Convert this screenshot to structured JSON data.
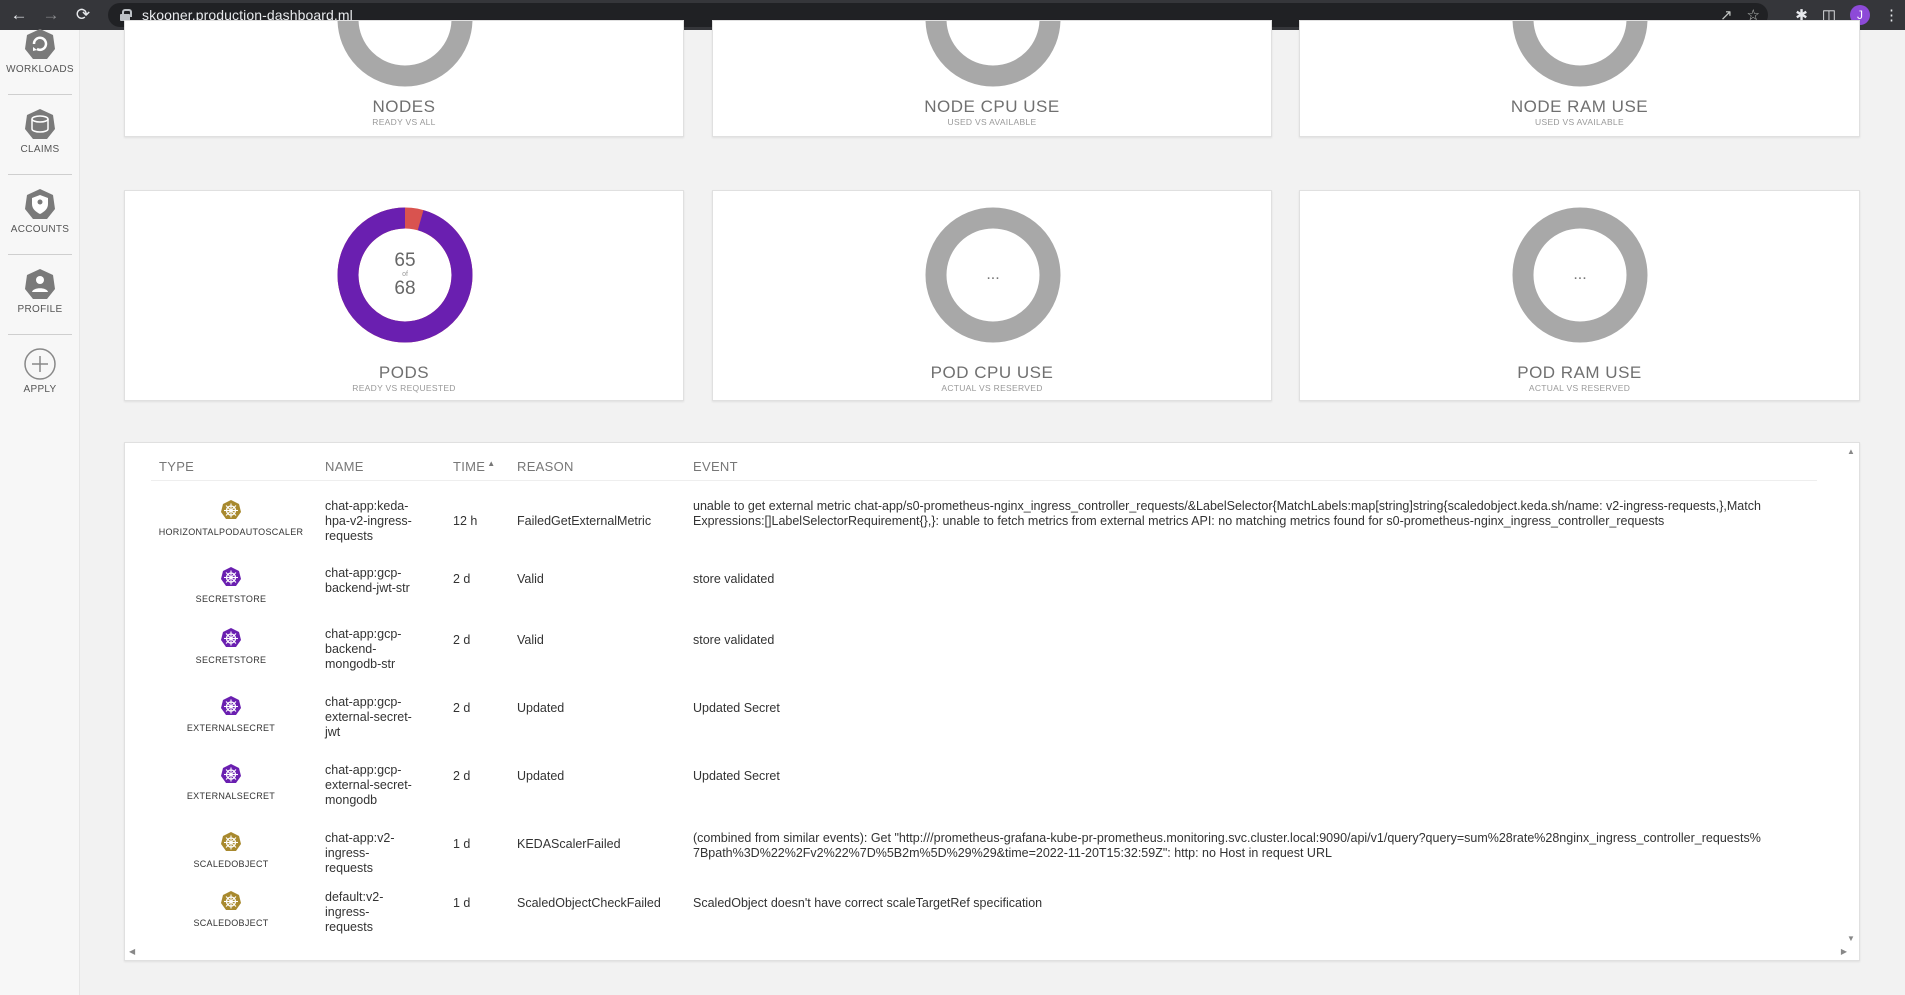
{
  "browser": {
    "url": "skooner.production-dashboard.ml",
    "avatar_letter": "J"
  },
  "sidebar": {
    "items": [
      {
        "label": "WORKLOADS",
        "icon": "workloads-icon"
      },
      {
        "label": "CLAIMS",
        "icon": "claims-icon"
      },
      {
        "label": "ACCOUNTS",
        "icon": "accounts-icon"
      },
      {
        "label": "PROFILE",
        "icon": "profile-icon"
      },
      {
        "label": "APPLY",
        "icon": "add-icon"
      }
    ]
  },
  "cards_top": [
    {
      "title": "NODES",
      "subtitle": "READY VS ALL"
    },
    {
      "title": "NODE CPU USE",
      "subtitle": "USED VS AVAILABLE"
    },
    {
      "title": "NODE RAM USE",
      "subtitle": "USED VS AVAILABLE"
    }
  ],
  "cards_bottom": [
    {
      "title": "PODS",
      "subtitle": "READY VS REQUESTED",
      "value": "65",
      "of_label": "of",
      "total": "68"
    },
    {
      "title": "POD CPU USE",
      "subtitle": "ACTUAL VS RESERVED",
      "placeholder": "..."
    },
    {
      "title": "POD RAM USE",
      "subtitle": "ACTUAL VS RESERVED",
      "placeholder": "..."
    }
  ],
  "pods_ready_fraction": 0.9559,
  "colors": {
    "accent": "#6a1fb0",
    "alert": "#d9534f",
    "empty_ring": "#a8a8a8",
    "warning_icon": "#a8892e",
    "normal_icon": "#6a1fb0"
  },
  "events": {
    "headers": {
      "type": "TYPE",
      "name": "NAME",
      "time": "TIME",
      "reason": "REASON",
      "event": "EVENT"
    },
    "rows": [
      {
        "type": "HORIZONTALPODAUTOSCALER",
        "kind": "warning",
        "name": "chat-app:keda-hpa-v2-ingress-requests",
        "time": "12 h",
        "reason": "FailedGetExternalMetric",
        "event": "unable to get external metric chat-app/s0-prometheus-nginx_ingress_controller_requests/&LabelSelector{MatchLabels:map[string]string{scaledobject.keda.sh/name: v2-ingress-requests,},MatchExpressions:[]LabelSelectorRequirement{},}: unable to fetch metrics from external metrics API: no matching metrics found for s0-prometheus-nginx_ingress_controller_requests"
      },
      {
        "type": "SECRETSTORE",
        "kind": "normal",
        "name": "chat-app:gcp-backend-jwt-str",
        "time": "2 d",
        "reason": "Valid",
        "event": "store validated"
      },
      {
        "type": "SECRETSTORE",
        "kind": "normal",
        "name": "chat-app:gcp-backend-mongodb-str",
        "time": "2 d",
        "reason": "Valid",
        "event": "store validated"
      },
      {
        "type": "EXTERNALSECRET",
        "kind": "normal",
        "name": "chat-app:gcp-external-secret-jwt",
        "time": "2 d",
        "reason": "Updated",
        "event": "Updated Secret"
      },
      {
        "type": "EXTERNALSECRET",
        "kind": "normal",
        "name": "chat-app:gcp-external-secret-mongodb",
        "time": "2 d",
        "reason": "Updated",
        "event": "Updated Secret"
      },
      {
        "type": "SCALEDOBJECT",
        "kind": "warning",
        "name": "chat-app:v2-ingress-requests",
        "time": "1 d",
        "reason": "KEDAScalerFailed",
        "event": "(combined from similar events): Get \"http:///prometheus-grafana-kube-pr-prometheus.monitoring.svc.cluster.local:9090/api/v1/query?query=sum%28rate%28nginx_ingress_controller_requests%7Bpath%3D%22%2Fv2%22%7D%5B2m%5D%29%29&time=2022-11-20T15:32:59Z\": http: no Host in request URL"
      },
      {
        "type": "SCALEDOBJECT",
        "kind": "warning",
        "name": "default:v2-ingress-requests",
        "time": "1 d",
        "reason": "ScaledObjectCheckFailed",
        "event": "ScaledObject doesn't have correct scaleTargetRef specification"
      }
    ]
  }
}
